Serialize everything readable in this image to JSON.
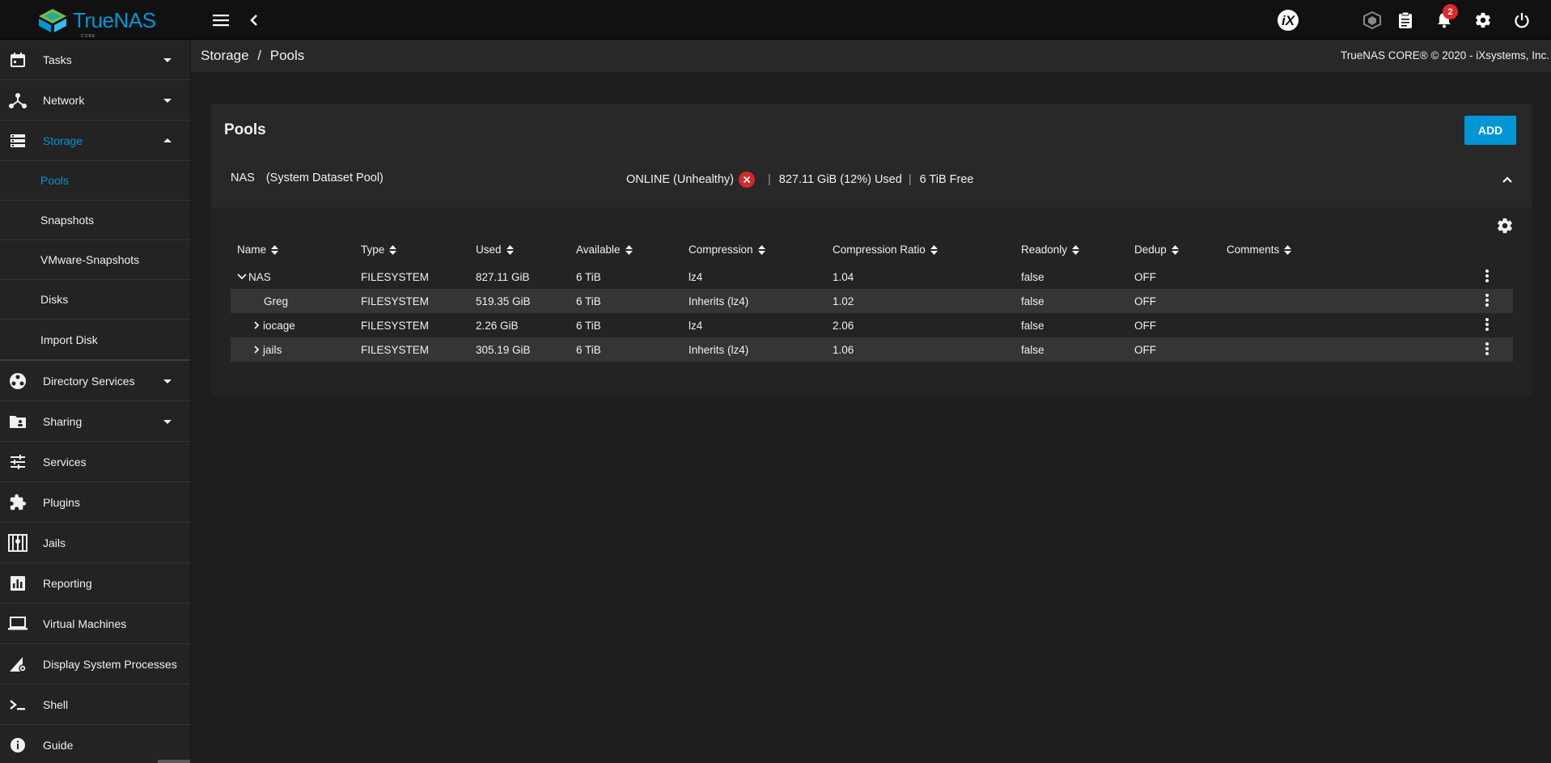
{
  "app": {
    "logo_text": "TrueNAS",
    "logo_sub": "CORE"
  },
  "topbar": {
    "menu_icon": "menu-icon",
    "back_icon": "chevron-left-icon",
    "ix_logo": "iX",
    "notifications_count": "2"
  },
  "sidebar": {
    "items": [
      {
        "label": "Tasks",
        "icon": "calendar-icon"
      },
      {
        "label": "Network",
        "icon": "network-icon"
      },
      {
        "label": "Storage",
        "icon": "storage-icon"
      }
    ],
    "storage_sub": [
      "Pools",
      "Snapshots",
      "VMware-Snapshots",
      "Disks",
      "Import Disk"
    ],
    "items2": [
      {
        "label": "Directory Services",
        "icon": "directory-icon"
      },
      {
        "label": "Sharing",
        "icon": "sharing-icon"
      },
      {
        "label": "Services",
        "icon": "services-icon"
      },
      {
        "label": "Plugins",
        "icon": "puzzle-icon"
      },
      {
        "label": "Jails",
        "icon": "jail-icon"
      },
      {
        "label": "Reporting",
        "icon": "chart-icon"
      },
      {
        "label": "Virtual Machines",
        "icon": "laptop-icon"
      },
      {
        "label": "Display System Processes",
        "icon": "processes-icon"
      },
      {
        "label": "Shell",
        "icon": "terminal-icon"
      },
      {
        "label": "Guide",
        "icon": "info-icon"
      }
    ]
  },
  "breadcrumb": {
    "root": "Storage",
    "sep": "/",
    "current": "Pools"
  },
  "copyright": "TrueNAS CORE® © 2020 - iXsystems, Inc.",
  "card": {
    "title": "Pools",
    "add_label": "ADD",
    "pool": {
      "name": "NAS",
      "system_label": "(System Dataset Pool)",
      "status": "ONLINE (Unhealthy)",
      "used": "827.11 GiB (12%) Used",
      "free": "6 TiB Free",
      "sep": "|"
    },
    "columns": [
      "Name",
      "Type",
      "Used",
      "Available",
      "Compression",
      "Compression Ratio",
      "Readonly",
      "Dedup",
      "Comments"
    ],
    "rows": [
      {
        "name": "NAS",
        "type": "FILESYSTEM",
        "used": "827.11 GiB",
        "available": "6 TiB",
        "compression": "lz4",
        "ratio": "1.04",
        "readonly": "false",
        "dedup": "OFF",
        "comments": ""
      },
      {
        "name": "Greg",
        "type": "FILESYSTEM",
        "used": "519.35 GiB",
        "available": "6 TiB",
        "compression": "Inherits (lz4)",
        "ratio": "1.02",
        "readonly": "false",
        "dedup": "OFF",
        "comments": ""
      },
      {
        "name": "iocage",
        "type": "FILESYSTEM",
        "used": "2.26 GiB",
        "available": "6 TiB",
        "compression": "lz4",
        "ratio": "2.06",
        "readonly": "false",
        "dedup": "OFF",
        "comments": ""
      },
      {
        "name": "jails",
        "type": "FILESYSTEM",
        "used": "305.19 GiB",
        "available": "6 TiB",
        "compression": "Inherits (lz4)",
        "ratio": "1.06",
        "readonly": "false",
        "dedup": "OFF",
        "comments": ""
      }
    ]
  },
  "colors": {
    "accent": "#0095d5",
    "error": "#d42a2a",
    "badge": "#e0292a"
  }
}
